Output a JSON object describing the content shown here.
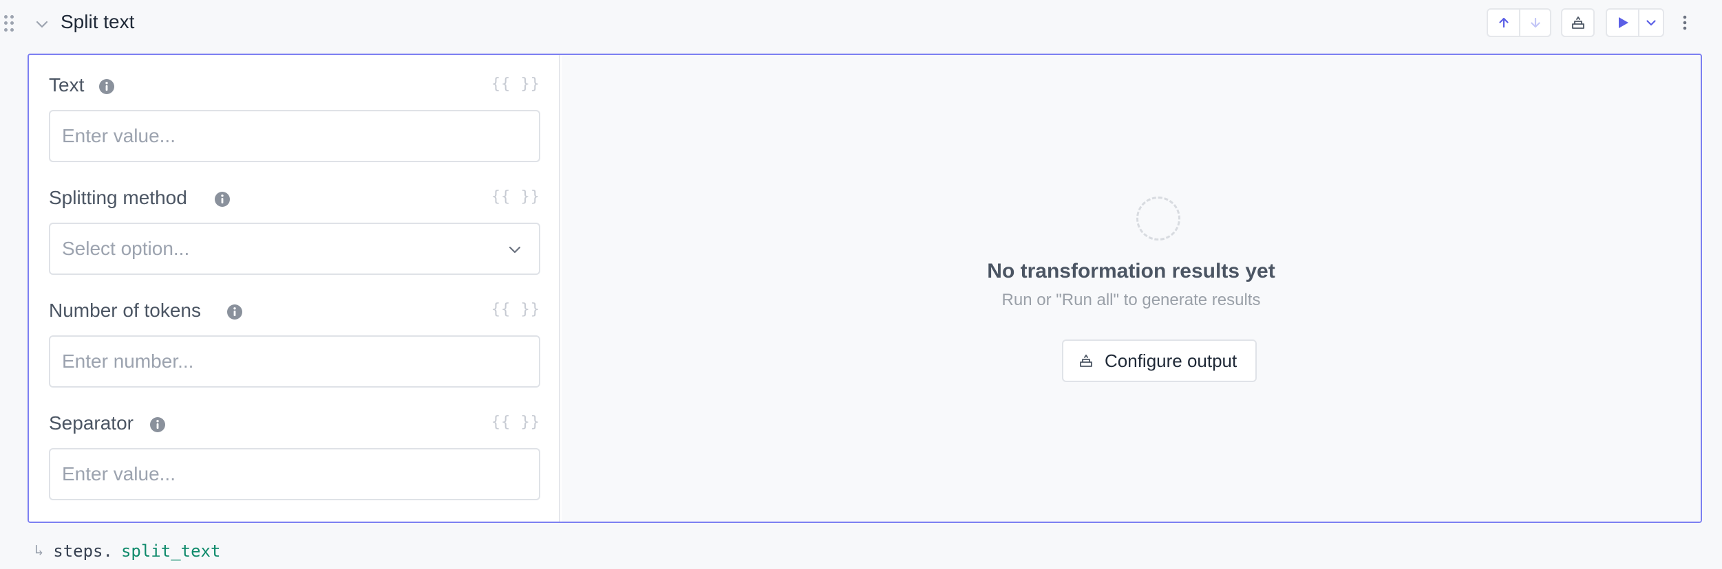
{
  "step": {
    "title": "Split text"
  },
  "fields": [
    {
      "label": "Text",
      "placeholder": "Enter value...",
      "var_label": "{{ }}"
    },
    {
      "label": "Splitting method",
      "placeholder": "Select option...",
      "var_label": "{{ }}"
    },
    {
      "label": "Number of tokens",
      "placeholder": "Enter number...",
      "var_label": "{{ }}"
    },
    {
      "label": "Separator",
      "placeholder": "Enter value...",
      "var_label": "{{ }}"
    }
  ],
  "output": {
    "empty_title": "No transformation results yet",
    "empty_subtitle": "Run or \"Run all\" to generate results",
    "configure_label": "Configure output"
  },
  "reference": {
    "arrow": "↳",
    "prefix": "steps.",
    "name": "split_text"
  },
  "icons": {
    "drag": "drag-handle-icon",
    "collapse": "chevron-down-icon",
    "move_up": "arrow-up-icon",
    "move_down": "arrow-down-icon",
    "output_config": "output-tray-icon",
    "run": "play-icon",
    "run_menu": "chevron-down-icon",
    "more": "more-vertical-icon",
    "info": "info-icon",
    "variable": "variable-braces-icon"
  },
  "colors": {
    "accent": "#6366f1",
    "card_border": "#7c7ff2",
    "reference_name": "#0f8a6b"
  }
}
